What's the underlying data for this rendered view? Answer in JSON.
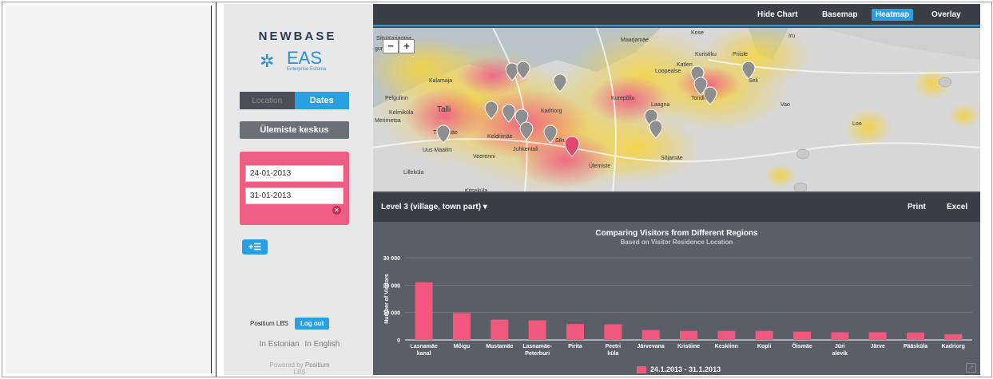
{
  "sidebar": {
    "logo_text": "NEWBASE",
    "eas_text": "EAS",
    "eas_subtitle": "Enterprise Estonia",
    "tab_location": "Location",
    "tab_dates": "Dates",
    "region_button": "Ülemiste keskus",
    "date_from": "24-01-2013",
    "date_to": "31-01-2013",
    "add_list_label": "+☰",
    "user_name": "Positium LBS",
    "logout": "Log out",
    "lang_estonian": "In Estonian",
    "lang_english": "In English",
    "powered_prefix": "Powered by",
    "powered_brand": "Positium",
    "powered_suffix": "LBS"
  },
  "topbar": {
    "hide_chart": "Hide Chart",
    "basemap": "Basemap",
    "heatmap": "Heatmap",
    "overlay": "Overlay"
  },
  "map": {
    "zoom_out": "−",
    "zoom_in": "+",
    "labels": [
      "Maarjamäe",
      "Kose",
      "Sitsi",
      "Karjamaa",
      "guranna",
      "Katleri",
      "Kuristiku",
      "Priisle",
      "Loopealse",
      "Kalamaja",
      "Pelgulinn",
      "Kurepõllu",
      "Laagna",
      "Tondiraba",
      "Kelmiküla",
      "Kadriorg",
      "Merimetsa",
      "Tõnismäe",
      "Keldrimäe",
      "Sikupilli",
      "Uus Maailm",
      "Veerenni",
      "Juhkentali",
      "Sõjamäe",
      "Ülemiste",
      "Lilleküla",
      "Kitseküla",
      "Vao",
      "Loo",
      "Seli",
      "Tallinn",
      "Iru"
    ]
  },
  "levelbar": {
    "level": "Level 3 (village, town part)",
    "print": "Print",
    "excel": "Excel"
  },
  "chart_data": {
    "type": "bar",
    "title": "Comparing Visitors from Different Regions",
    "subtitle": "Based on Visitor Residence Location",
    "ylabel": "Number of Visitors",
    "ylim": [
      0,
      30000
    ],
    "yticks": [
      "0",
      "10 000",
      "20 000",
      "30 000"
    ],
    "categories": [
      "Lasnamäe kanal",
      "Mõigu",
      "Mustamäe",
      "Lasnamäe-Peterburi",
      "Pirita",
      "Peetri küla",
      "Järvevana",
      "Kristiine",
      "Kesklinn",
      "Kopli",
      "Õismäe",
      "Jüri alevik",
      "Järve",
      "Pääsküla",
      "Kadriorg"
    ],
    "category_lines": [
      [
        "Lasnamäe",
        "kanal"
      ],
      [
        "Mõigu"
      ],
      [
        "Mustamäe"
      ],
      [
        "Lasnamäe-",
        "Peterburi"
      ],
      [
        "Pirita"
      ],
      [
        "Peetri",
        "küla"
      ],
      [
        "Järvevana"
      ],
      [
        "Kristiine"
      ],
      [
        "Kesklinn"
      ],
      [
        "Kopli"
      ],
      [
        "Õismäe"
      ],
      [
        "Jüri",
        "alevik"
      ],
      [
        "Järve"
      ],
      [
        "Pääsküla"
      ],
      [
        "Kadriorg"
      ]
    ],
    "series": [
      {
        "name": "24.1.2013 - 31.1.2013",
        "values": [
          21000,
          9800,
          7400,
          7100,
          5800,
          5700,
          3600,
          3300,
          3300,
          3300,
          3000,
          2800,
          2800,
          2700,
          2100
        ],
        "color": "#f0587e"
      }
    ]
  },
  "colors": {
    "accent": "#2aa0e0",
    "pink": "#ee5e84",
    "dark": "#3a3e45"
  }
}
